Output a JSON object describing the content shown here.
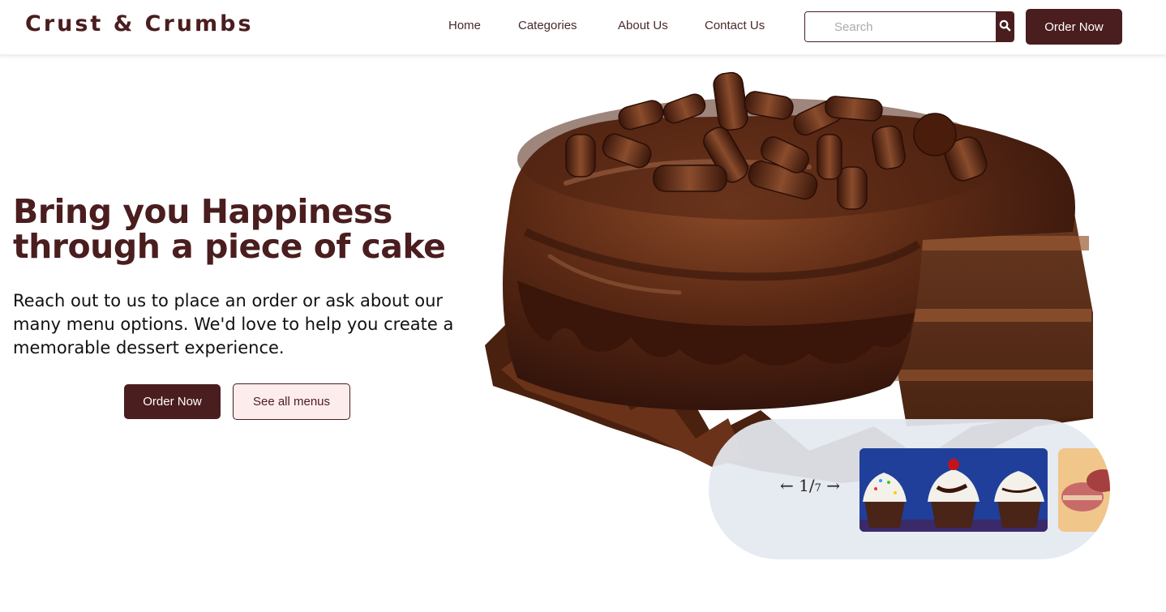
{
  "brand": {
    "name": "Crust & Crumbs"
  },
  "nav": {
    "items": [
      {
        "label": "Home"
      },
      {
        "label": "Categories"
      },
      {
        "label": "About Us"
      },
      {
        "label": "Contact Us"
      }
    ]
  },
  "search": {
    "placeholder": "Search",
    "value": "",
    "icon": "search-icon"
  },
  "header": {
    "order_label": "Order Now"
  },
  "hero": {
    "title_line1": "Bring you Happiness",
    "title_line2": "through a piece of cake",
    "description": "Reach out to us to place an order or ask about our many menu options. We'd love to help you create a memorable dessert experience.",
    "primary_button": "Order Now",
    "secondary_button": "See all menus",
    "image": "chocolate-cake"
  },
  "carousel": {
    "counter_current": "1",
    "counter_total": "7",
    "slides": [
      "cupcakes",
      "macarons"
    ]
  },
  "colors": {
    "brand": "#4a1d1f",
    "secondary_button_bg": "#fdecec",
    "carousel_bg": "#e4e8f0"
  }
}
